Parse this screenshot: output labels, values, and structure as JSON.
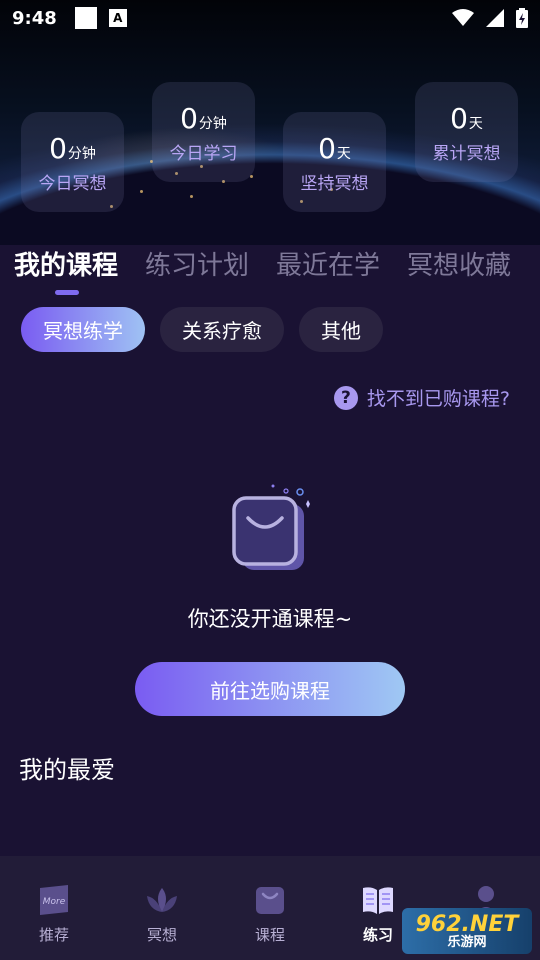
{
  "status_bar": {
    "time": "9:48",
    "a_badge": "A"
  },
  "stats": [
    {
      "value": "0",
      "unit": "分钟",
      "label": "今日冥想"
    },
    {
      "value": "0",
      "unit": "分钟",
      "label": "今日学习"
    },
    {
      "value": "0",
      "unit": "天",
      "label": "坚持冥想"
    },
    {
      "value": "0",
      "unit": "天",
      "label": "累计冥想"
    }
  ],
  "tabs": [
    {
      "label": "我的课程",
      "active": true
    },
    {
      "label": "练习计划",
      "active": false
    },
    {
      "label": "最近在学",
      "active": false
    },
    {
      "label": "冥想收藏",
      "active": false
    }
  ],
  "chips": [
    {
      "label": "冥想练学",
      "active": true
    },
    {
      "label": "关系疗愈",
      "active": false
    },
    {
      "label": "其他",
      "active": false
    }
  ],
  "help": {
    "icon": "question-icon",
    "glyph": "?",
    "text": "找不到已购课程?"
  },
  "empty_state": {
    "message": "你还没开通课程~",
    "cta": "前往选购课程"
  },
  "favorites": {
    "title": "我的最爱"
  },
  "bottom_nav": [
    {
      "label": "推荐",
      "icon": "more-icon",
      "icon_text": "More",
      "active": false
    },
    {
      "label": "冥想",
      "icon": "lotus-icon",
      "active": false
    },
    {
      "label": "课程",
      "icon": "bag-icon",
      "active": false
    },
    {
      "label": "练习",
      "icon": "book-icon",
      "active": true
    },
    {
      "label": "",
      "icon": "profile-icon",
      "active": false
    }
  ],
  "watermark": {
    "top": "962.NET",
    "bottom": "乐游网"
  },
  "colors": {
    "background": "#1a1233",
    "accent": "#7a5cf2",
    "accent_light": "#9fc2f3",
    "stat_label": "#b9a6f5",
    "help_text": "#a898ef",
    "nav_bg": "#221c38"
  }
}
